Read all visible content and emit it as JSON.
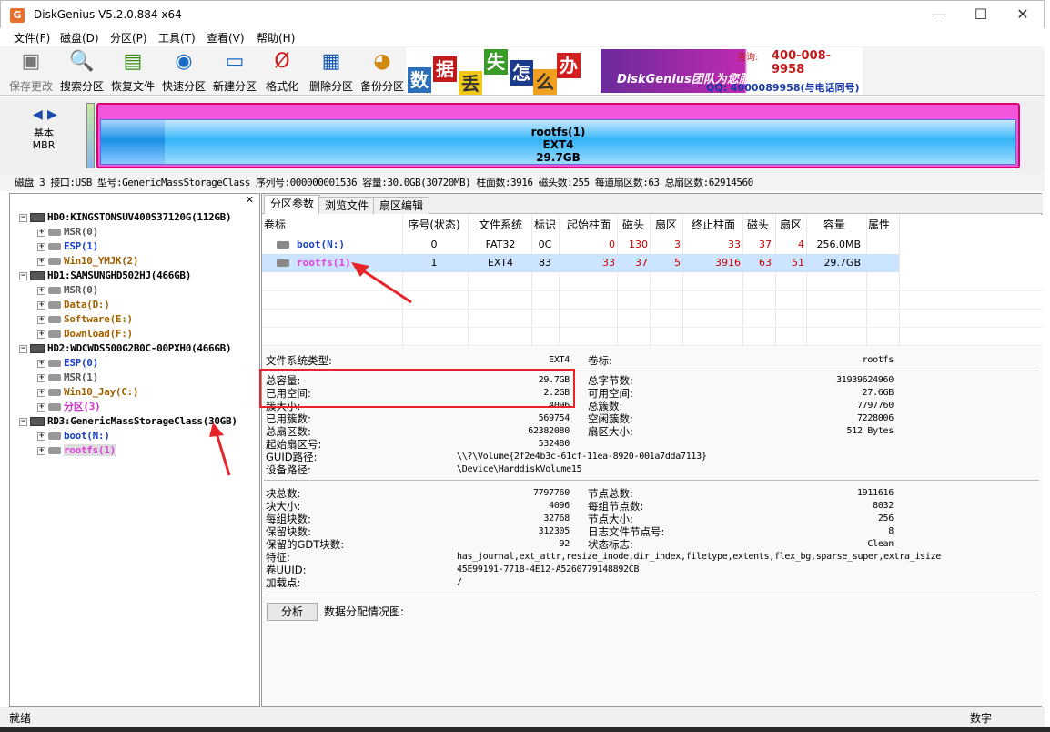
{
  "window": {
    "title": "DiskGenius V5.2.0.884 x64",
    "icon": "G",
    "minimize": "—",
    "maximize": "☐",
    "close": "✕"
  },
  "menu": [
    "文件(F)",
    "磁盘(D)",
    "分区(P)",
    "工具(T)",
    "查看(V)",
    "帮助(H)"
  ],
  "toolbar": [
    {
      "label": "保存更改",
      "icon": "save-icon"
    },
    {
      "label": "搜索分区",
      "icon": "magnifier-icon"
    },
    {
      "label": "恢复文件",
      "icon": "restore-icon"
    },
    {
      "label": "快速分区",
      "icon": "quick-partition-icon"
    },
    {
      "label": "新建分区",
      "icon": "new-partition-icon"
    },
    {
      "label": "格式化",
      "icon": "format-icon"
    },
    {
      "label": "删除分区",
      "icon": "trash-icon"
    },
    {
      "label": "备份分区",
      "icon": "backup-icon"
    }
  ],
  "banner": {
    "chars": [
      "数",
      "据",
      "丢",
      "失",
      "怎",
      "么",
      "办"
    ],
    "slogan": "DiskGenius团队为您服务!",
    "phone_label": "咨询:",
    "phone": "400-008-9958",
    "qq": "QQ: 4000089958(与电话同号)"
  },
  "diskmap": {
    "basic_line1": "基本",
    "basic_line2": "MBR",
    "partition_name": "rootfs(1)",
    "partition_fs": "EXT4",
    "partition_size": "29.7GB"
  },
  "diskinfo": "磁盘 3 接口:USB  型号:GenericMassStorageClass  序列号:000000001536  容量:30.0GB(30720MB)  柱面数:3916  磁头数:255  每道扇区数:63  总扇区数:62914560",
  "tree": [
    {
      "label": "HD0:KINGSTONSUV400S37120G(112GB)",
      "level": 0,
      "color": "#000"
    },
    {
      "label": "MSR(0)",
      "level": 1,
      "color": "#555"
    },
    {
      "label": "ESP(1)",
      "level": 1,
      "color": "#1a3fc4"
    },
    {
      "label": "Win10_YMJK(2)",
      "level": 1,
      "color": "#a06000"
    },
    {
      "label": "HD1:SAMSUNGHD502HJ(466GB)",
      "level": 0,
      "color": "#000"
    },
    {
      "label": "MSR(0)",
      "level": 1,
      "color": "#555"
    },
    {
      "label": "Data(D:)",
      "level": 1,
      "color": "#a06000"
    },
    {
      "label": "Software(E:)",
      "level": 1,
      "color": "#a06000"
    },
    {
      "label": "Download(F:)",
      "level": 1,
      "color": "#a06000"
    },
    {
      "label": "HD2:WDCWDS500G2B0C-00PXH0(466GB)",
      "level": 0,
      "color": "#000"
    },
    {
      "label": "ESP(0)",
      "level": 1,
      "color": "#1a3fc4"
    },
    {
      "label": "MSR(1)",
      "level": 1,
      "color": "#555"
    },
    {
      "label": "Win10_Jay(C:)",
      "level": 1,
      "color": "#a06000"
    },
    {
      "label": "分区(3)",
      "level": 1,
      "color": "#cc33cc"
    },
    {
      "label": "RD3:GenericMassStorageClass(30GB)",
      "level": 0,
      "color": "#000"
    },
    {
      "label": "boot(N:)",
      "level": 1,
      "color": "#1a3fc4"
    },
    {
      "label": "rootfs(1)",
      "level": 1,
      "color": "#e040e0"
    }
  ],
  "tabs": [
    "分区参数",
    "浏览文件",
    "扇区编辑"
  ],
  "table": {
    "headers": [
      "卷标",
      "序号(状态)",
      "文件系统",
      "标识",
      "起始柱面",
      "磁头",
      "扇区",
      "终止柱面",
      "磁头",
      "扇区",
      "容量",
      "属性"
    ],
    "rows": [
      [
        "boot(N:)",
        "0",
        "FAT32",
        "0C",
        "0",
        "130",
        "3",
        "33",
        "37",
        "4",
        "256.0MB",
        ""
      ],
      [
        "rootfs(1)",
        "1",
        "EXT4",
        "83",
        "33",
        "37",
        "5",
        "3916",
        "63",
        "51",
        "29.7GB",
        ""
      ]
    ]
  },
  "details": {
    "fs_type_label": "文件系统类型:",
    "fs_type": "EXT4",
    "vol_label_label": "卷标:",
    "vol_label": "rootfs",
    "left": [
      {
        "k": "总容量:",
        "v": "29.7GB"
      },
      {
        "k": "已用空间:",
        "v": "2.2GB"
      },
      {
        "k": "簇大小:",
        "v": "4096"
      },
      {
        "k": "已用簇数:",
        "v": "569754"
      },
      {
        "k": "总扇区数:",
        "v": "62382080"
      },
      {
        "k": "起始扇区号:",
        "v": "532480"
      }
    ],
    "right": [
      {
        "k": "总字节数:",
        "v": "31939624960"
      },
      {
        "k": "可用空间:",
        "v": "27.6GB"
      },
      {
        "k": "总簇数:",
        "v": "7797760"
      },
      {
        "k": "空闲簇数:",
        "v": "7228006"
      },
      {
        "k": "扇区大小:",
        "v": "512 Bytes"
      }
    ],
    "guid_label": "GUID路径:",
    "guid": "\\\\?\\Volume{2f2e4b3c-61cf-11ea-8920-001a7dda7113}",
    "dev_label": "设备路径:",
    "dev": "\\Device\\HarddiskVolume15",
    "ext_left": [
      {
        "k": "块总数:",
        "v": "7797760"
      },
      {
        "k": "块大小:",
        "v": "4096"
      },
      {
        "k": "每组块数:",
        "v": "32768"
      },
      {
        "k": "保留块数:",
        "v": "312305"
      },
      {
        "k": "保留的GDT块数:",
        "v": "92"
      }
    ],
    "ext_right": [
      {
        "k": "节点总数:",
        "v": "1911616"
      },
      {
        "k": "每组节点数:",
        "v": "8032"
      },
      {
        "k": "节点大小:",
        "v": "256"
      },
      {
        "k": "日志文件节点号:",
        "v": "8"
      },
      {
        "k": "状态标志:",
        "v": "Clean"
      }
    ],
    "features_label": "特征:",
    "features": "has_journal,ext_attr,resize_inode,dir_index,filetype,extents,flex_bg,sparse_super,extra_isize",
    "uuid_label": "卷UUID:",
    "uuid": "45E99191-771B-4E12-A5260779148892CB",
    "mount_label": "加载点:",
    "mount": "/",
    "analyze_btn": "分析",
    "alloc_label": "数据分配情况图:"
  },
  "status": {
    "left": "就绪",
    "right": "数字"
  },
  "colors": {
    "accent_red": "#e8232a",
    "partition_pink": "#f255dc",
    "partition_blue": "#33b4f8"
  }
}
